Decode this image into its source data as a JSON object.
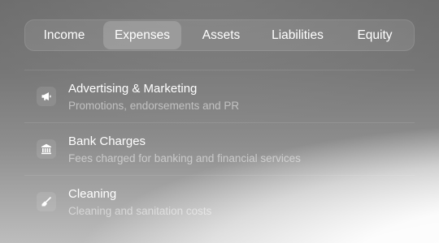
{
  "tabs": [
    {
      "label": "Income",
      "active": false
    },
    {
      "label": "Expenses",
      "active": true
    },
    {
      "label": "Assets",
      "active": false
    },
    {
      "label": "Liabilities",
      "active": false
    },
    {
      "label": "Equity",
      "active": false
    }
  ],
  "categories": [
    {
      "icon": "megaphone-icon",
      "title": "Advertising & Marketing",
      "description": "Promotions, endorsements and PR"
    },
    {
      "icon": "bank-icon",
      "title": "Bank Charges",
      "description": "Fees charged for banking and financial services"
    },
    {
      "icon": "broom-icon",
      "title": "Cleaning",
      "description": "Cleaning and sanitation costs"
    }
  ]
}
